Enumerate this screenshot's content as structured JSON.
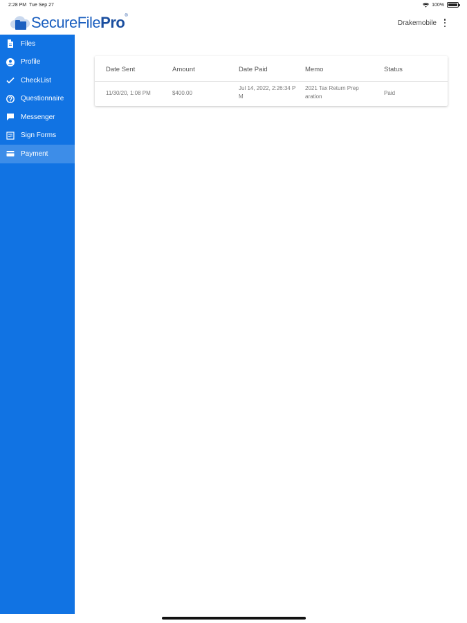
{
  "status_bar": {
    "time": "2:28 PM",
    "date": "Tue Sep 27",
    "battery": "100%"
  },
  "header": {
    "logo": {
      "part1": "SecureFile",
      "part2": "Pro",
      "tm": "®"
    },
    "username": "Drakemobile"
  },
  "sidebar": {
    "items": [
      {
        "label": "Files",
        "icon": "file-icon"
      },
      {
        "label": "Profile",
        "icon": "user-circle-icon"
      },
      {
        "label": "CheckList",
        "icon": "check-icon"
      },
      {
        "label": "Questionnaire",
        "icon": "question-circle-icon"
      },
      {
        "label": "Messenger",
        "icon": "chat-icon"
      },
      {
        "label": "Sign Forms",
        "icon": "sign-form-icon"
      },
      {
        "label": "Payment",
        "icon": "credit-card-icon"
      }
    ],
    "active_index": 6,
    "color": "#1173e3"
  },
  "payments_table": {
    "columns": [
      "Date Sent",
      "Amount",
      "Date Paid",
      "Memo",
      "Status"
    ],
    "rows": [
      {
        "date_sent": "11/30/20, 1:08 PM",
        "amount": "$400.00",
        "date_paid_line1": "Jul 14, 2022, 2:26:34 P",
        "date_paid_line2": "M",
        "memo_line1": "2021 Tax Return Prep",
        "memo_line2": "aration",
        "status": "Paid"
      }
    ]
  }
}
